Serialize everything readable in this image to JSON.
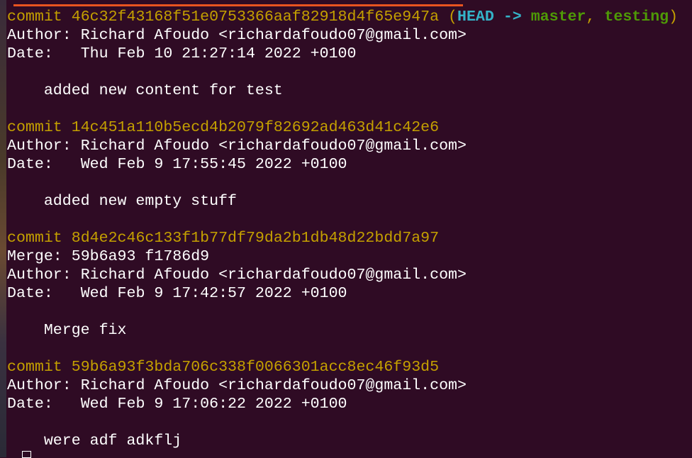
{
  "colors": {
    "background": "#2f0b24",
    "commit_hash": "#c4a000",
    "head_ref": "#34b3c8",
    "branch_ref": "#4e9a06",
    "text": "#ffffff",
    "tab_accent": "#e95420"
  },
  "commits": [
    {
      "commit_label": "commit",
      "hash": "46c32f43168f51e0753366aaf82918d4f65e947a",
      "refs": {
        "open_paren": "(",
        "head": "HEAD",
        "arrow": "->",
        "branch1": "master",
        "separator": ",",
        "branch2": "testing",
        "close_paren": ")"
      },
      "author_label": "Author:",
      "author": "Richard Afoudo <richardafoudo07@gmail.com>",
      "date_label": "Date:",
      "date": "Thu Feb 10 21:27:14 2022 +0100",
      "message": "added new content for test"
    },
    {
      "commit_label": "commit",
      "hash": "14c451a110b5ecd4b2079f82692ad463d41c42e6",
      "author_label": "Author:",
      "author": "Richard Afoudo <richardafoudo07@gmail.com>",
      "date_label": "Date:",
      "date": "Wed Feb 9 17:55:45 2022 +0100",
      "message": "added new empty stuff"
    },
    {
      "commit_label": "commit",
      "hash": "8d4e2c46c133f1b77df79da2b1db48d22bdd7a97",
      "merge_label": "Merge:",
      "merge": "59b6a93 f1786d9",
      "author_label": "Author:",
      "author": "Richard Afoudo <richardafoudo07@gmail.com>",
      "date_label": "Date:",
      "date": "Wed Feb 9 17:42:57 2022 +0100",
      "message": "Merge fix"
    },
    {
      "commit_label": "commit",
      "hash": "59b6a93f3bda706c338f0066301acc8ec46f93d5",
      "author_label": "Author:",
      "author": "Richard Afoudo <richardafoudo07@gmail.com>",
      "date_label": "Date:",
      "date": "Wed Feb 9 17:06:22 2022 +0100",
      "message": "were adf adkflj"
    }
  ]
}
